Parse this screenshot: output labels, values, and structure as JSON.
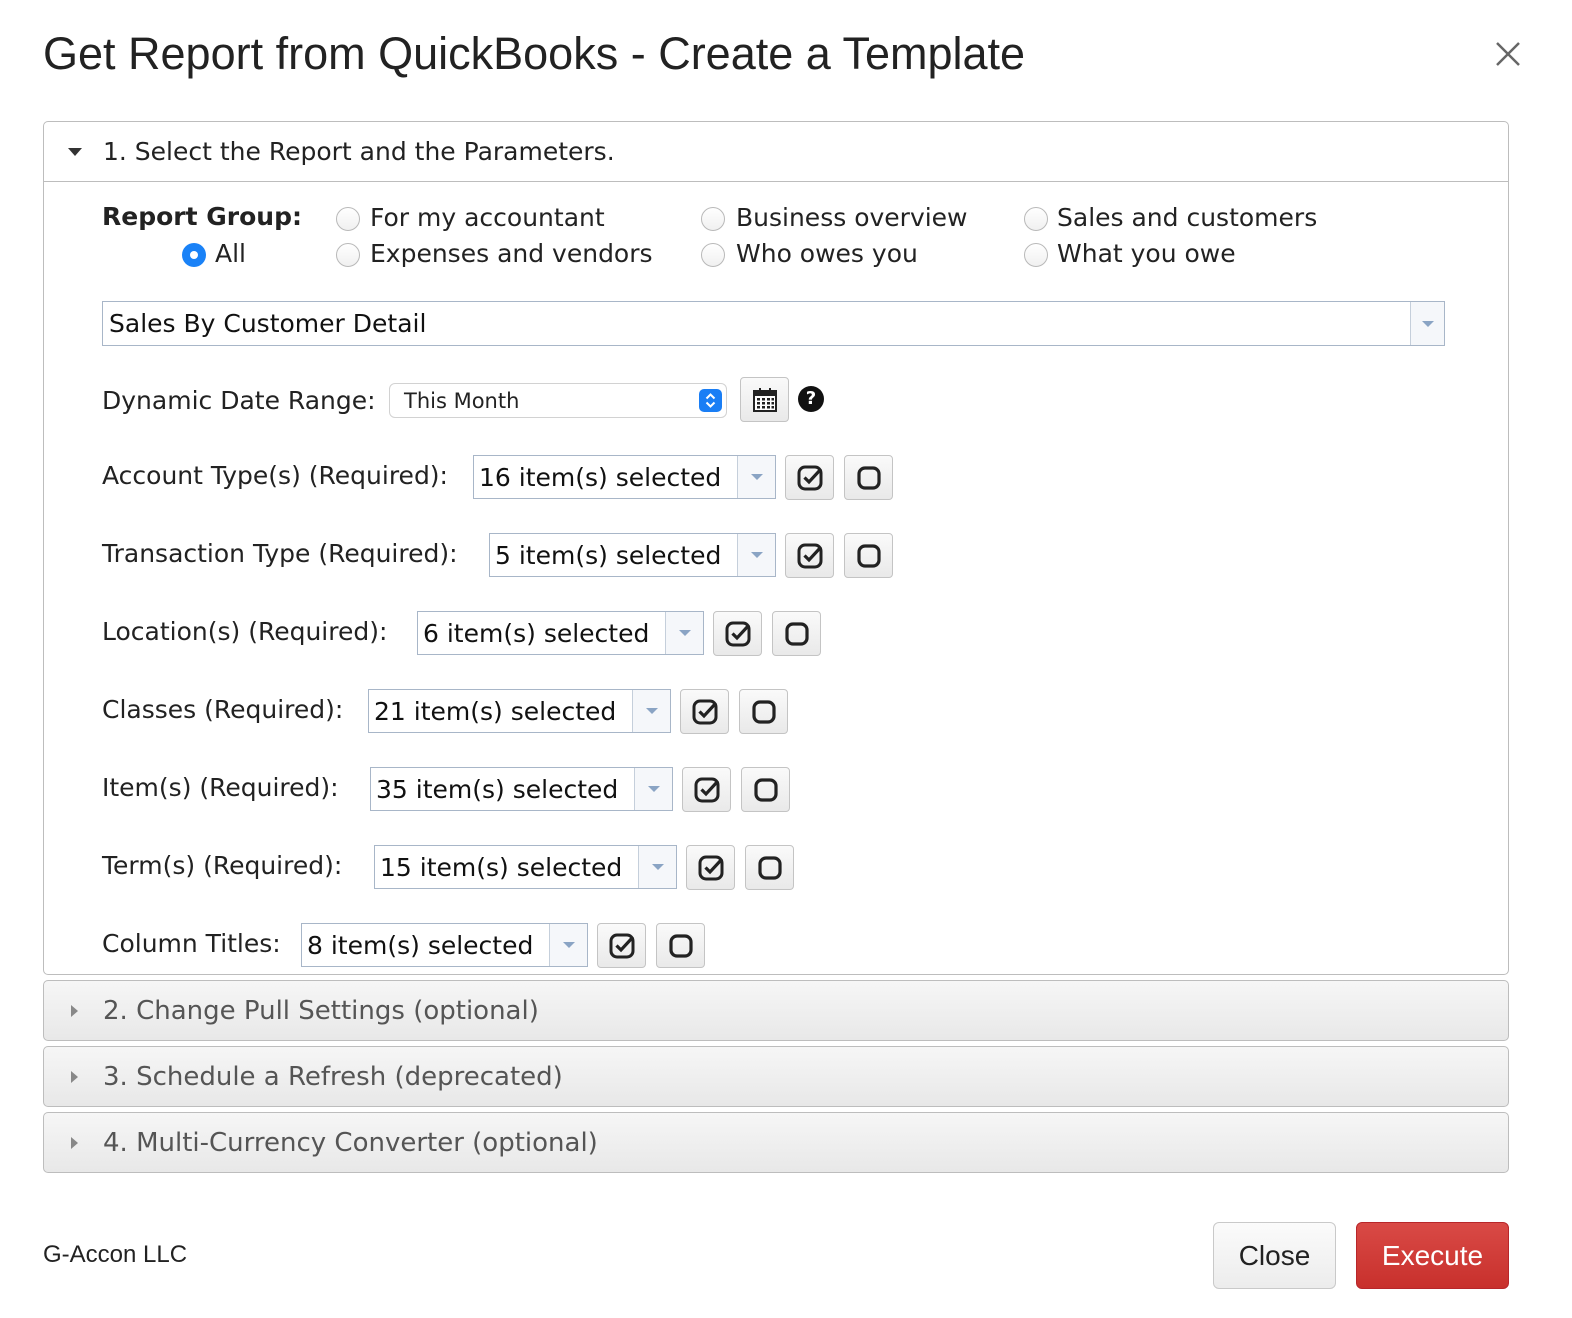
{
  "dialog": {
    "title": "Get Report from QuickBooks - Create a Template",
    "close_icon": "close-icon"
  },
  "sections": [
    {
      "label": "1. Select the Report and the Parameters.",
      "expanded": true
    },
    {
      "label": "2. Change Pull Settings (optional)",
      "expanded": false
    },
    {
      "label": "3. Schedule a Refresh (deprecated)",
      "expanded": false
    },
    {
      "label": "4. Multi-Currency Converter (optional)",
      "expanded": false
    }
  ],
  "report_group": {
    "label": "Report Group:",
    "options": [
      {
        "label": "All",
        "checked": true
      },
      {
        "label": "For my accountant",
        "checked": false
      },
      {
        "label": "Expenses and vendors",
        "checked": false
      },
      {
        "label": "Business overview",
        "checked": false
      },
      {
        "label": "Who owes you",
        "checked": false
      },
      {
        "label": "Sales and customers",
        "checked": false
      },
      {
        "label": "What you owe",
        "checked": false
      }
    ]
  },
  "report_select": {
    "value": "Sales By Customer Detail"
  },
  "date_range": {
    "label": "Dynamic Date Range:",
    "value": "This Month",
    "calendar_icon": "calendar-icon",
    "help_icon": "?"
  },
  "parameters": [
    {
      "label": "Account Type(s) (Required):",
      "value": "16 item(s) selected"
    },
    {
      "label": "Transaction Type (Required):",
      "value": "5 item(s) selected"
    },
    {
      "label": "Location(s) (Required):",
      "value": "6 item(s) selected"
    },
    {
      "label": "Classes (Required):",
      "value": "21 item(s) selected"
    },
    {
      "label": "Item(s) (Required):",
      "value": "35 item(s) selected"
    },
    {
      "label": "Term(s) (Required):",
      "value": "15 item(s) selected"
    },
    {
      "label": "Column Titles:",
      "value": "8 item(s) selected"
    }
  ],
  "footer": {
    "brand": "G-Accon LLC",
    "close_label": "Close",
    "execute_label": "Execute",
    "execute_color": "#cf3a36"
  }
}
